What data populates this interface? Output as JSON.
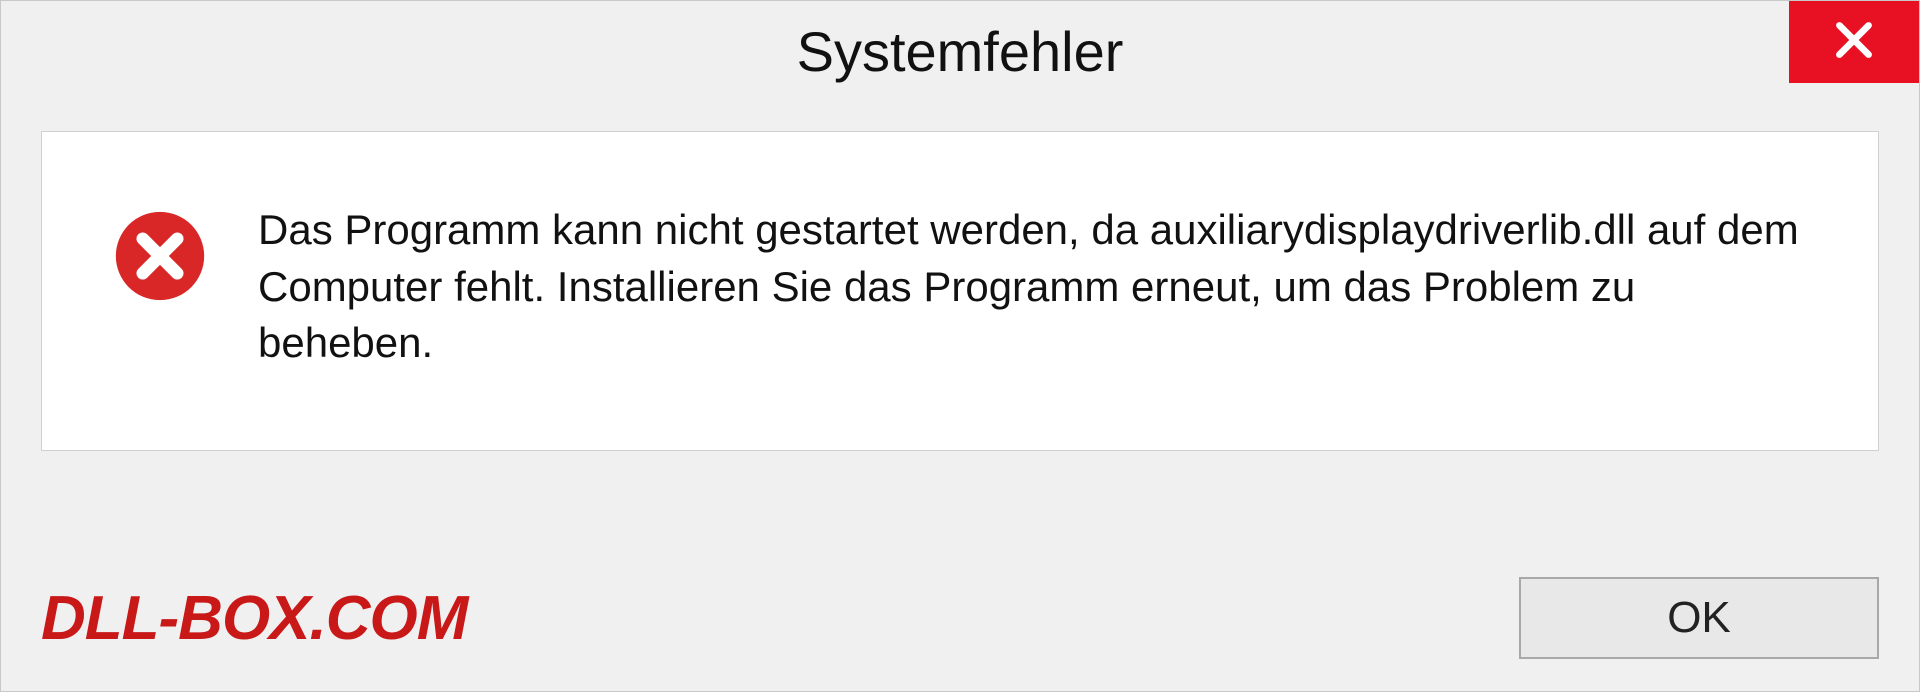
{
  "dialog": {
    "title": "Systemfehler",
    "message": "Das Programm kann nicht gestartet werden, da auxiliarydisplaydriverlib.dll auf dem Computer fehlt. Installieren Sie das Programm erneut, um das Problem zu beheben.",
    "ok_label": "OK",
    "close_icon": "close-icon",
    "error_icon": "error-circle-x-icon"
  },
  "watermark": "DLL-BOX.COM",
  "colors": {
    "close_bg": "#e81123",
    "error_icon_fill": "#d92626",
    "watermark": "#c91818",
    "dialog_bg": "#f0f0f0",
    "content_bg": "#ffffff"
  }
}
